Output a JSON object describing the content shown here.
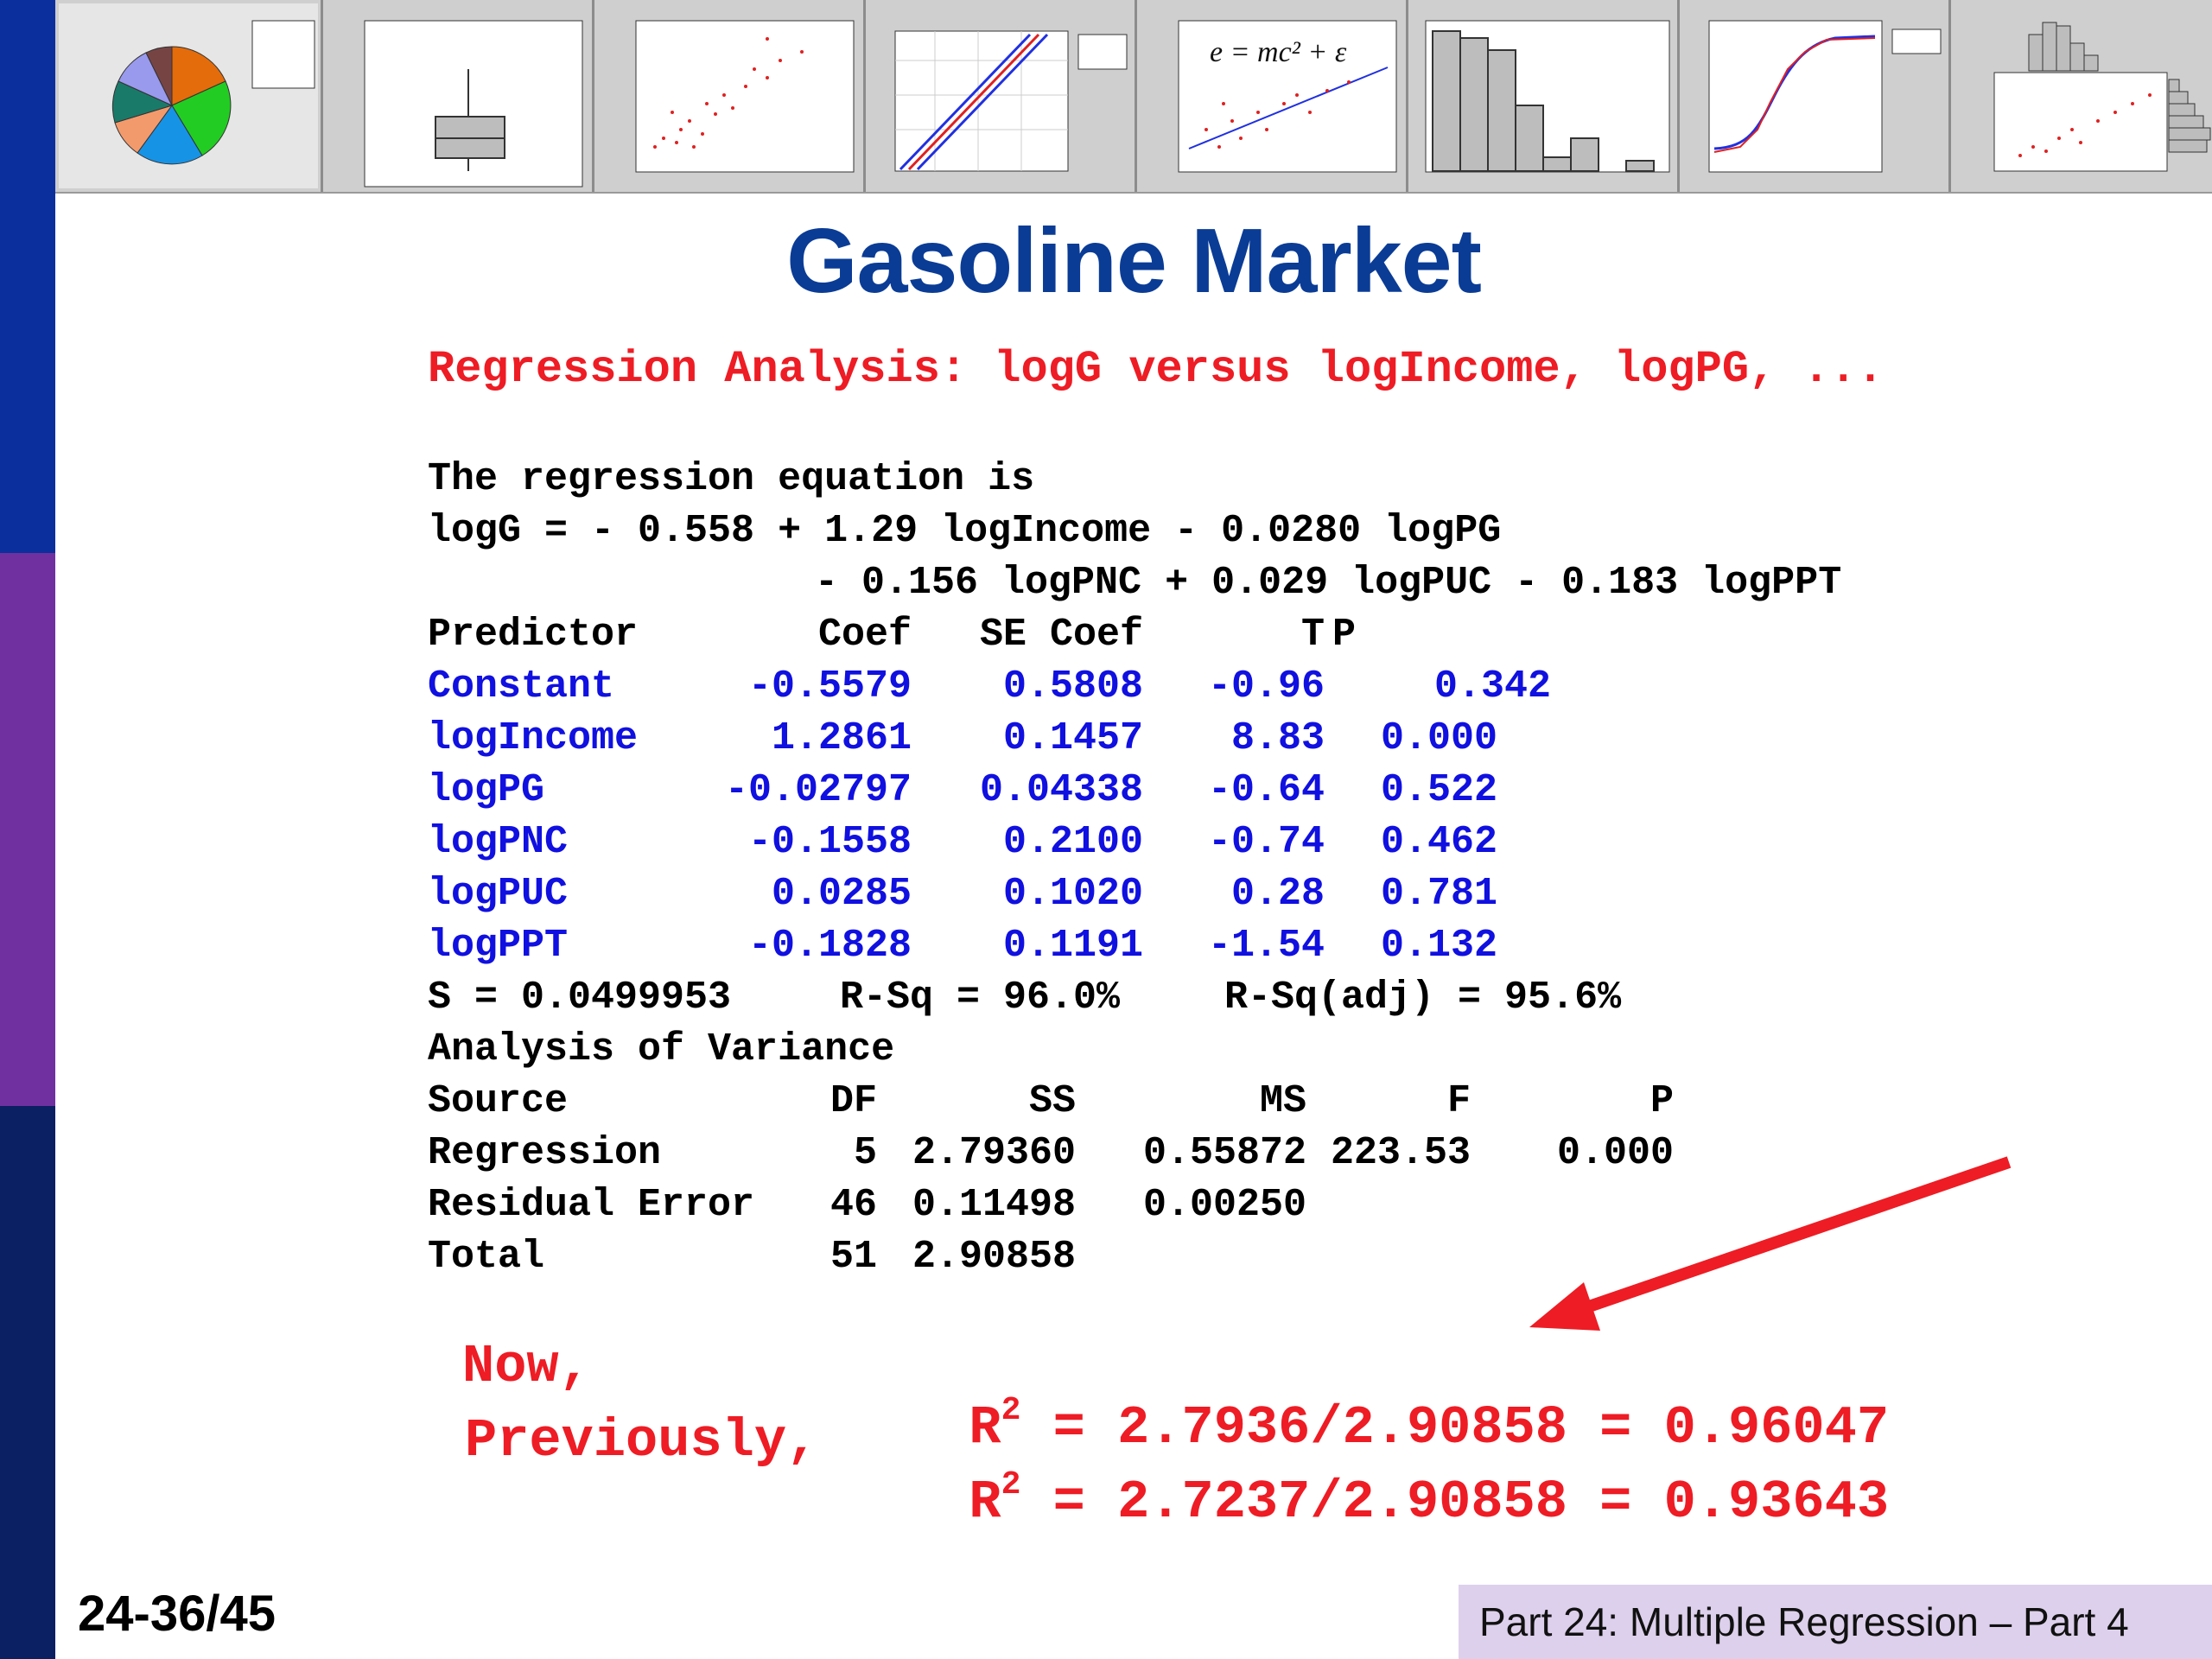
{
  "slide": {
    "title": "Gasoline Market",
    "subtitle": "Regression Analysis: logG versus logIncome, logPG, ...",
    "equation_intro": "The regression equation is",
    "equation_line1": "logG = - 0.558 + 1.29 logIncome - 0.0280 logPG",
    "equation_line2": "- 0.156 logPNC + 0.029 logPUC - 0.183 logPPT",
    "coef_headers": [
      "Predictor",
      "Coef",
      "SE Coef",
      "T",
      "P"
    ],
    "coef_rows": [
      [
        "Constant",
        "-0.5579",
        "0.5808",
        "-0.96",
        "0.342"
      ],
      [
        "logIncome",
        "1.2861",
        "0.1457",
        "8.83",
        "0.000"
      ],
      [
        "logPG",
        "-0.02797",
        "0.04338",
        "-0.64",
        "0.522"
      ],
      [
        "logPNC",
        "-0.1558",
        "0.2100",
        "-0.74",
        "0.462"
      ],
      [
        "logPUC",
        "0.0285",
        "0.1020",
        "0.28",
        "0.781"
      ],
      [
        "logPPT",
        "-0.1828",
        "0.1191",
        "-1.54",
        "0.132"
      ]
    ],
    "fit_stats": [
      "S = 0.0499953",
      "R-Sq = 96.0%",
      "R-Sq(adj) = 95.6%"
    ],
    "anova_title": "Analysis of Variance",
    "anova_headers": [
      "Source",
      "DF",
      "SS",
      "MS",
      "F",
      "P"
    ],
    "anova_rows": [
      [
        "Regression",
        "5",
        "2.79360",
        "0.55872",
        "223.53",
        "0.000"
      ],
      [
        "Residual Error",
        "46",
        "0.11498",
        "0.00250",
        "",
        ""
      ],
      [
        "Total",
        "51",
        "2.90858",
        "",
        "",
        ""
      ]
    ],
    "now_label": "Now,",
    "now_r": "R",
    "now_sup": "2",
    "now_expr": "= 2.7936/2.90858 = 0.96047",
    "prev_label": "Previously,",
    "prev_r": "R",
    "prev_sup": "2",
    "prev_expr": "= 2.7237/2.90858 = 0.93643",
    "slide_number": "24-36/45",
    "footer_text": "Part 24: Multiple Regression – Part 4",
    "formula_thumb": "e = mc² + ε"
  },
  "colors": {
    "title": "#0a3c96",
    "highlight_red": "#ee1c24",
    "table_blue": "#1010e0",
    "sidebar_top": "#0b2f9c",
    "sidebar_mid": "#7030a0",
    "sidebar_bottom": "#0b1f63",
    "footer_box": "#ddd0ec"
  }
}
